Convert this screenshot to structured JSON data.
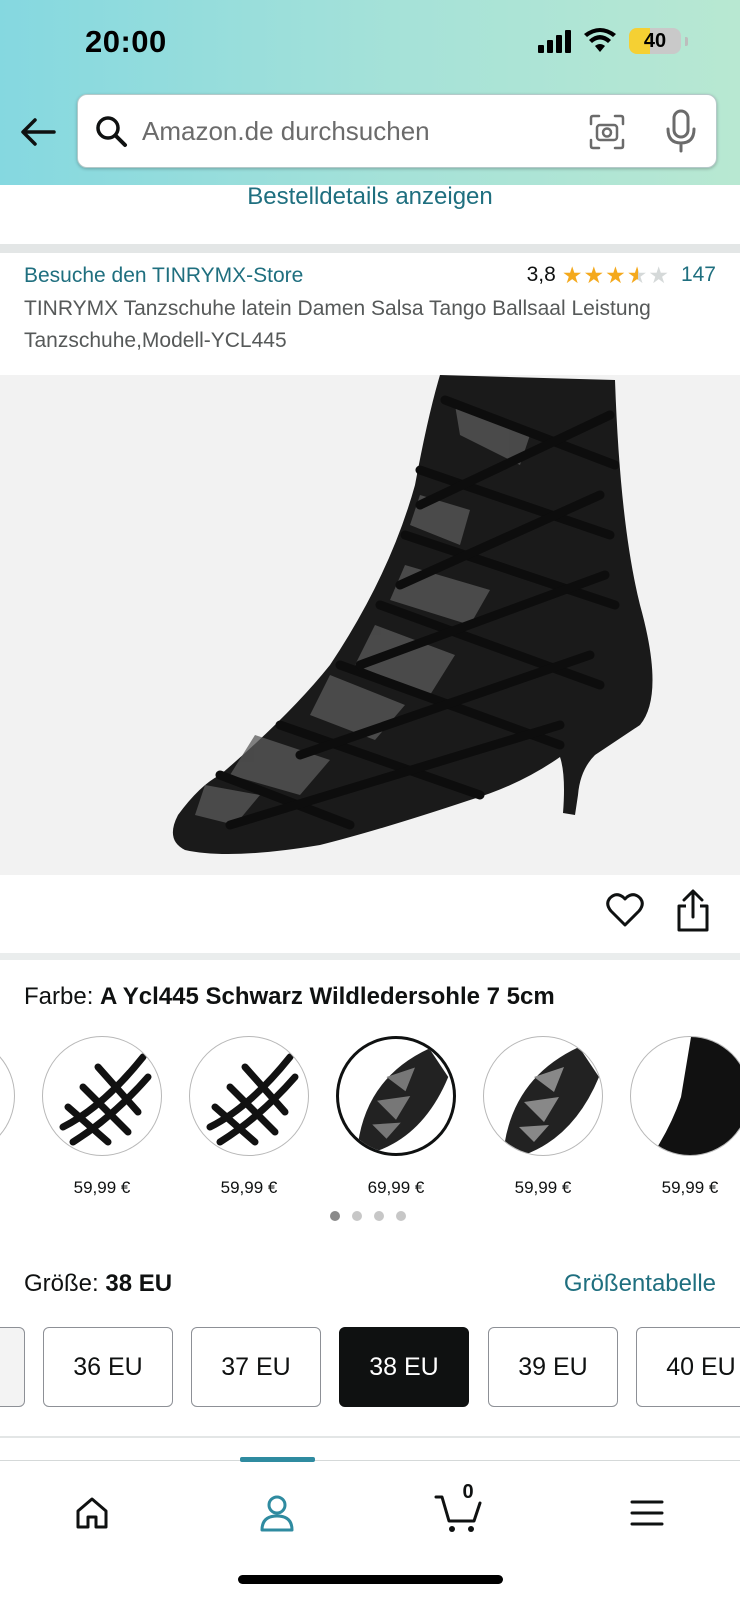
{
  "status_bar": {
    "time": "20:00",
    "battery": "40",
    "battery_level": 0.4
  },
  "search": {
    "placeholder": "Amazon.de durchsuchen"
  },
  "order": {
    "link": "Bestelldetails anzeigen"
  },
  "product": {
    "store_link": "Besuche den TINRYMX-Store",
    "rating_value": "3,8",
    "rating_stars": 3.8,
    "rating_count": "147",
    "title": "TINRYMX Tanzschuhe latein Damen Salsa Tango Ballsaal Leistung Tanzschuhe,Modell-YCL445"
  },
  "image_carousel": {
    "dots": 4,
    "active_index": 0
  },
  "color": {
    "label": "Farbe:",
    "value": "A Ycl445 Schwarz Wildledersohle 7 5cm",
    "swatches": [
      {
        "price": "59,99 €"
      },
      {
        "price": "59,99 €"
      },
      {
        "price": "69,99 €",
        "selected": true
      },
      {
        "price": "59,99 €"
      },
      {
        "price": "59,99 €"
      }
    ]
  },
  "size": {
    "label": "Größe:",
    "value": "38 EU",
    "chart_link": "Größentabelle",
    "options": [
      "36 EU",
      "37 EU",
      "38 EU",
      "39 EU",
      "40 EU"
    ],
    "selected": "38 EU"
  },
  "bottom_nav": {
    "cart_count": "0",
    "active": "account"
  },
  "colors": {
    "link": "#1f6f7f",
    "star": "#f4a91d",
    "nav_accent": "#2f8ba0"
  }
}
